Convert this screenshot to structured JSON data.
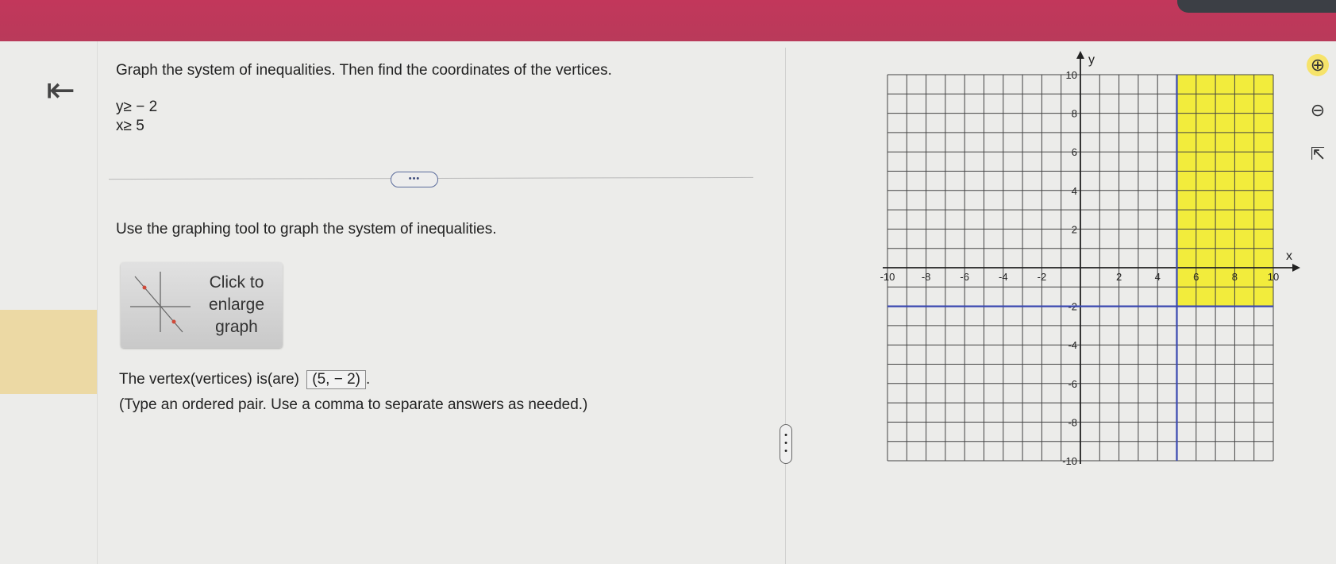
{
  "question": {
    "title": "Graph the system of inequalities. Then find the coordinates of the vertices.",
    "inequalities": [
      "y≥ − 2",
      "x≥ 5"
    ]
  },
  "more_button": "•••",
  "instruction": "Use the graphing tool to graph the system of inequalities.",
  "thumbnail_label": "Click to\nenlarge\ngraph",
  "vertex": {
    "prefix": "The vertex(vertices) is(are)",
    "answer": "(5, − 2)",
    "suffix": "."
  },
  "hint": "(Type an ordered pair. Use a comma to separate answers as needed.)",
  "splitter": "•\n•\n•",
  "graph": {
    "x_axis_label": "x",
    "y_axis_label": "y",
    "x_ticks": [
      "-10",
      "-8",
      "-6",
      "-4",
      "-2",
      "2",
      "4",
      "6",
      "8",
      "10"
    ],
    "y_ticks": [
      "10",
      "8",
      "6",
      "4",
      "2",
      "-2",
      "-4",
      "-6",
      "-8",
      "-10"
    ],
    "boundary_x": 5,
    "boundary_y": -2,
    "shade_color": "#f2ec3c",
    "line_color": "#3a48b0"
  },
  "tools": {
    "zoom_in": "zoom-in-icon",
    "zoom_out": "zoom-out-icon",
    "popout": "popout-icon"
  },
  "colors": {
    "header": "#b83a5a",
    "page": "#ececea",
    "highlight": "#ecd9a4"
  }
}
